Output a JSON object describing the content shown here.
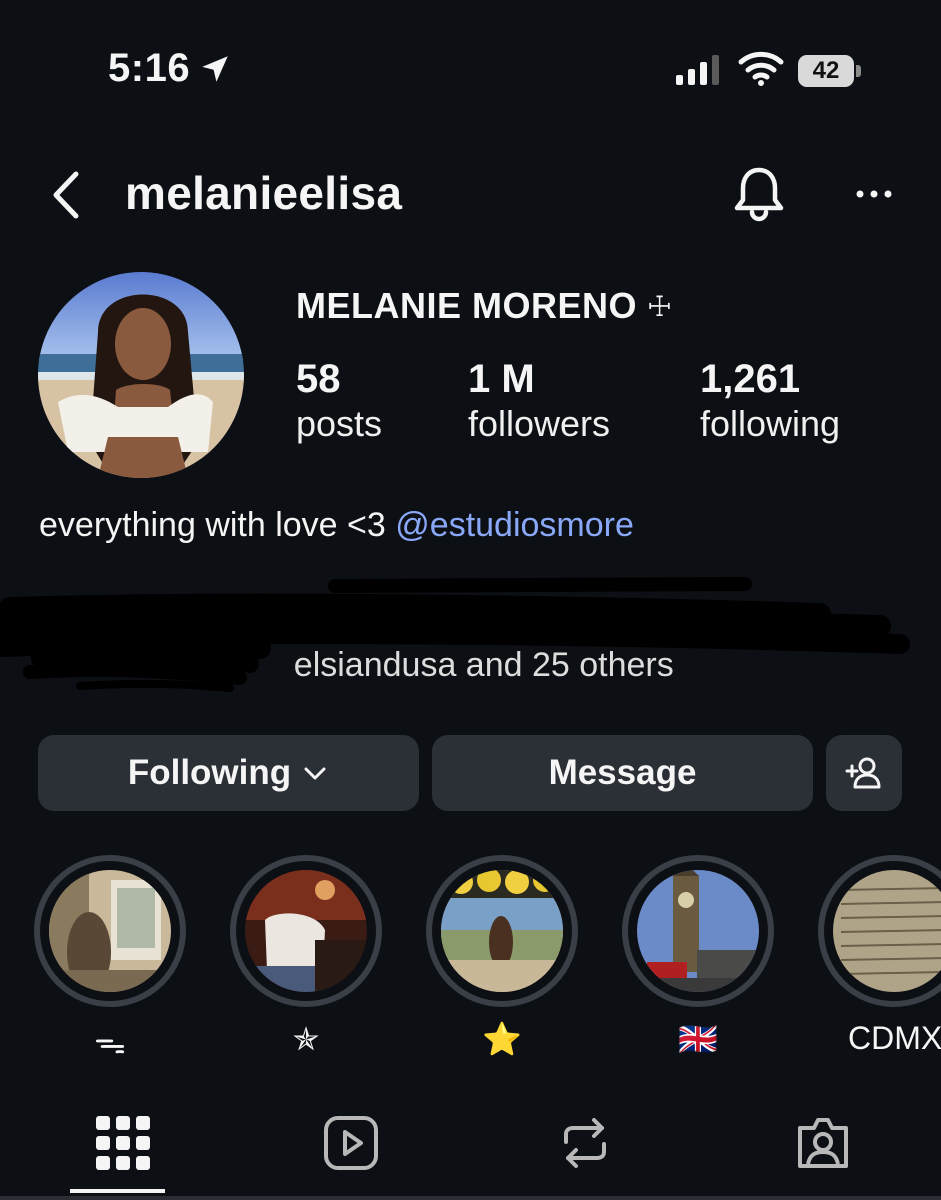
{
  "status_bar": {
    "time": "5:16",
    "battery": "42"
  },
  "header": {
    "username": "melanieelisa"
  },
  "profile": {
    "full_name": "MELANIE MORENO",
    "name_symbol": "☩",
    "stats": [
      {
        "value": "58",
        "label": "posts"
      },
      {
        "value": "1 M",
        "label": "followers"
      },
      {
        "value": "1,261",
        "label": "following"
      }
    ],
    "bio": {
      "text": "everything with love <3",
      "mention": "@estudiosmore"
    },
    "followed_by": "    elsiandusa and 25 others"
  },
  "actions": {
    "following": "Following",
    "message": "Message"
  },
  "highlights": [
    {
      "label": "ᯓ"
    },
    {
      "label": "✯"
    },
    {
      "label": "⭐"
    },
    {
      "label": "🇬🇧"
    },
    {
      "label": "CDMX"
    }
  ],
  "tabs": [
    "grid-icon",
    "reels-icon",
    "reposts-icon",
    "tagged-icon"
  ]
}
